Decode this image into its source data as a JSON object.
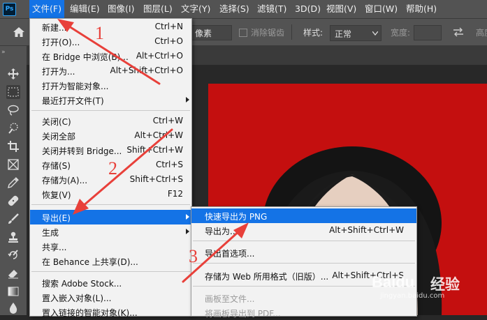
{
  "app": {
    "logo": "Ps"
  },
  "menubar": {
    "items": [
      {
        "label": "文件(F)",
        "active": true
      },
      {
        "label": "编辑(E)"
      },
      {
        "label": "图像(I)"
      },
      {
        "label": "图层(L)"
      },
      {
        "label": "文字(Y)"
      },
      {
        "label": "选择(S)"
      },
      {
        "label": "滤镜(T)"
      },
      {
        "label": "3D(D)"
      },
      {
        "label": "视图(V)"
      },
      {
        "label": "窗口(W)"
      },
      {
        "label": "帮助(H)"
      }
    ]
  },
  "options": {
    "pixel_unit": "像素",
    "antialias_label": "消除锯齿",
    "style_label": "样式:",
    "style_value": "正常",
    "width_label": "宽度:",
    "height_label": "高度"
  },
  "file_menu": {
    "items": [
      {
        "label": "新建...",
        "shortcut": "Ctrl+N"
      },
      {
        "label": "打开(O)...",
        "shortcut": "Ctrl+O"
      },
      {
        "label": "在 Bridge 中浏览(B)...",
        "shortcut": "Alt+Ctrl+O"
      },
      {
        "label": "打开为...",
        "shortcut": "Alt+Shift+Ctrl+O"
      },
      {
        "label": "打开为智能对象..."
      },
      {
        "label": "最近打开文件(T)",
        "submenu": true
      },
      {
        "label": "关闭(C)",
        "shortcut": "Ctrl+W"
      },
      {
        "label": "关闭全部",
        "shortcut": "Alt+Ctrl+W"
      },
      {
        "label": "关闭并转到 Bridge...",
        "shortcut": "Shift+Ctrl+W"
      },
      {
        "label": "存储(S)",
        "shortcut": "Ctrl+S"
      },
      {
        "label": "存储为(A)...",
        "shortcut": "Shift+Ctrl+S"
      },
      {
        "label": "恢复(V)",
        "shortcut": "F12"
      },
      {
        "label": "导出(E)",
        "submenu": true,
        "highlighted": true
      },
      {
        "label": "生成",
        "submenu": true
      },
      {
        "label": "共享..."
      },
      {
        "label": "在 Behance 上共享(D)..."
      },
      {
        "label": "搜索 Adobe Stock..."
      },
      {
        "label": "置入嵌入对象(L)..."
      },
      {
        "label": "置入链接的智能对象(K)..."
      }
    ]
  },
  "export_submenu": {
    "items": [
      {
        "label": "快速导出为 PNG",
        "highlighted": true
      },
      {
        "label": "导出为...",
        "shortcut": "Alt+Shift+Ctrl+W"
      },
      {
        "label": "导出首选项..."
      },
      {
        "label": "存储为 Web 所用格式（旧版）...",
        "shortcut": "Alt+Shift+Ctrl+S"
      },
      {
        "label": "画板至文件...",
        "disabled": true
      },
      {
        "label": "将画板导出到 PDF...",
        "disabled": true
      }
    ]
  },
  "annotations": {
    "steps": [
      "1",
      "2",
      "3"
    ],
    "arrow_color": "#e8403a"
  },
  "watermark": {
    "brand": "Baidu",
    "text": "经验",
    "url": "jingyan.baidu.com"
  },
  "colors": {
    "menu_highlight": "#1473e6",
    "photo_background": "#c40f0f",
    "chrome": "#535353"
  }
}
